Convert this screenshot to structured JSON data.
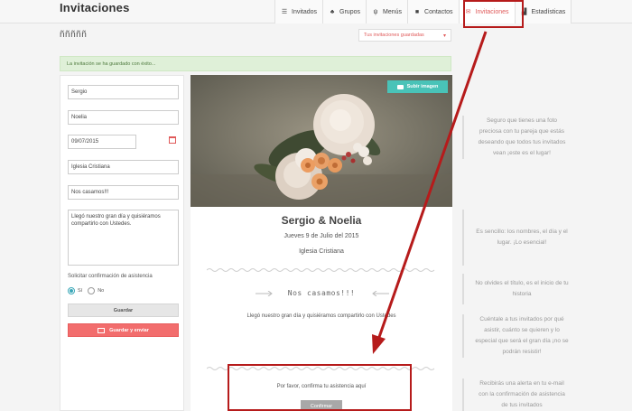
{
  "app": {
    "title": "Invitaciones"
  },
  "nav": [
    {
      "label": "Invitados",
      "icon": "list-icon"
    },
    {
      "label": "Grupos",
      "icon": "sitemap-icon"
    },
    {
      "label": "Menús",
      "icon": "cutlery-icon"
    },
    {
      "label": "Contactos",
      "icon": "book-icon"
    },
    {
      "label": "Invitaciones",
      "icon": "envelope-icon",
      "active": true
    },
    {
      "label": "Estadísticas",
      "icon": "chart-icon"
    }
  ],
  "page": {
    "title": "ñññññ",
    "saved_select": "Tus invitaciones guardadas",
    "alert": "La invitación se ha guardado con éxito..."
  },
  "form": {
    "groom": "Sergio",
    "bride": "Noelia",
    "date": "09/07/2015",
    "place": "Iglesia Cristiana",
    "title": "Nos casamos!!!",
    "message": "Llegó nuestro gran día y quisiéramos compartirlo con Ustedes.",
    "confirm_label": "Solicitar confirmación de asistencia",
    "yes": "Sí",
    "no": "No",
    "save": "Guardar",
    "save_send": "Guardar y enviar"
  },
  "preview": {
    "upload": "Subir imagen",
    "names": "Sergio & Noelia",
    "date": "Jueves 9 de Julio del 2015",
    "venue": "Iglesia Cristiana",
    "title": "Nos casamos!!!",
    "message": "Llegó nuestro gran día y quisiéramos compartirlo con Ustedes",
    "confirm_text": "Por favor, confirma tu asistencia aquí",
    "confirm_button": "Confirmar"
  },
  "tips": [
    "Seguro que tienes una foto preciosa con tu pareja que estás deseando que todos tus invitados vean ¡este es el lugar!",
    "Es sencillo: los nombres, el día y el lugar. ¡Lo esencial!",
    "No olvides el título, es el inicio de tu historia",
    "Cuéntale a tus invitados por qué asistir, cuánto se quieren y lo especial que será el gran día ¡no se podrán resistir!",
    "Recibirás una alerta en tu e-mail con la confirmación de asistencia de tus invitados"
  ],
  "colors": {
    "accent": "#e05a5a",
    "teal": "#49c3b8",
    "annotation": "#b61b1b"
  }
}
